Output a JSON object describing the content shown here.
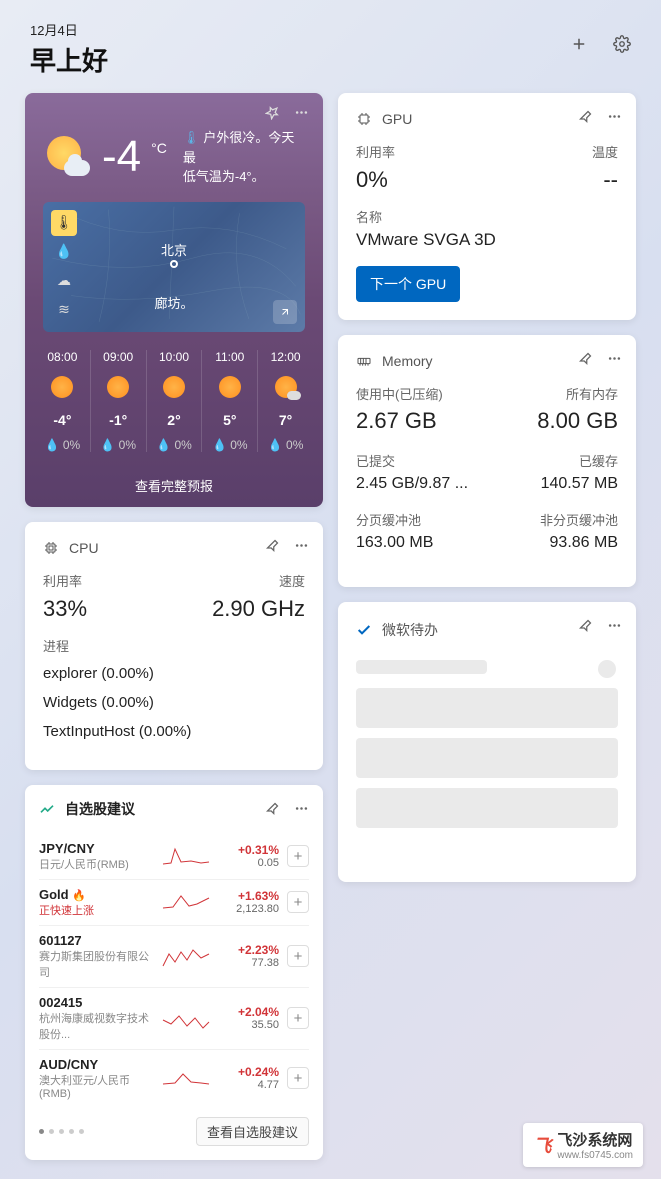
{
  "header": {
    "date": "12月4日",
    "greeting": "早上好"
  },
  "weather": {
    "temp": "-4",
    "unit": "°C",
    "desc1": "户外很冷。今天最",
    "desc2": "低气温为-4°。",
    "city1": "北京",
    "city2": "廊坊。",
    "forecast": [
      {
        "time": "08:00",
        "temp": "-4°",
        "rain": "0%",
        "cloud": false
      },
      {
        "time": "09:00",
        "temp": "-1°",
        "rain": "0%",
        "cloud": false
      },
      {
        "time": "10:00",
        "temp": "2°",
        "rain": "0%",
        "cloud": false
      },
      {
        "time": "11:00",
        "temp": "5°",
        "rain": "0%",
        "cloud": false
      },
      {
        "time": "12:00",
        "temp": "7°",
        "rain": "0%",
        "cloud": true
      }
    ],
    "footer": "查看完整预报"
  },
  "cpu": {
    "title": "CPU",
    "util_label": "利用率",
    "speed_label": "速度",
    "util": "33%",
    "speed": "2.90 GHz",
    "proc_label": "进程",
    "procs": [
      "explorer (0.00%)",
      "Widgets (0.00%)",
      "TextInputHost (0.00%)"
    ]
  },
  "gpu": {
    "title": "GPU",
    "util_label": "利用率",
    "temp_label": "温度",
    "util": "0%",
    "temp": "--",
    "name_label": "名称",
    "name": "VMware SVGA 3D",
    "button": "下一个 GPU"
  },
  "memory": {
    "title": "Memory",
    "used_label": "使用中(已压缩)",
    "total_label": "所有内存",
    "used": "2.67 GB",
    "total": "8.00 GB",
    "commit_label": "已提交",
    "cached_label": "已缓存",
    "commit": "2.45 GB/9.87 ...",
    "cached": "140.57 MB",
    "paged_label": "分页缓冲池",
    "nonpaged_label": "非分页缓冲池",
    "paged": "163.00 MB",
    "nonpaged": "93.86 MB"
  },
  "todo": {
    "title": "微软待办"
  },
  "stocks": {
    "title": "自选股建议",
    "rows": [
      {
        "sym": "JPY/CNY",
        "sub": "日元/人民币(RMB)",
        "change": "+0.31%",
        "price": "0.05",
        "hot": false,
        "up": false
      },
      {
        "sym": "Gold",
        "sub": "正快速上涨",
        "change": "+1.63%",
        "price": "2,123.80",
        "hot": true,
        "up": true
      },
      {
        "sym": "601127",
        "sub": "赛力斯集团股份有限公司",
        "change": "+2.23%",
        "price": "77.38",
        "hot": false,
        "up": false
      },
      {
        "sym": "002415",
        "sub": "杭州海康威视数字技术股份...",
        "change": "+2.04%",
        "price": "35.50",
        "hot": false,
        "up": false
      },
      {
        "sym": "AUD/CNY",
        "sub": "澳大利亚元/人民币(RMB)",
        "change": "+0.24%",
        "price": "4.77",
        "hot": false,
        "up": false
      }
    ],
    "footer_btn": "查看自选股建议"
  },
  "watermark": {
    "text": "飞沙系统网",
    "url": "www.fs0745.com"
  }
}
